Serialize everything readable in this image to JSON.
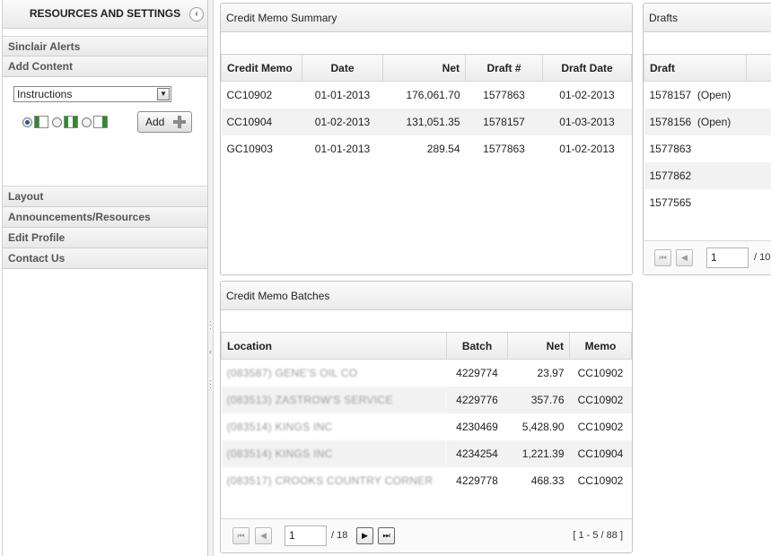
{
  "sidebar": {
    "title": "RESOURCES AND SETTINGS",
    "collapse_glyph": "‹",
    "sections": {
      "alerts": "Sinclair Alerts",
      "add_content": "Add Content",
      "layout": "Layout",
      "announcements": "Announcements/Resources",
      "edit_profile": "Edit Profile",
      "contact": "Contact Us"
    },
    "add_content": {
      "select_value": "Instructions",
      "add_label": "Add"
    }
  },
  "summary": {
    "title": "Credit Memo Summary",
    "columns": [
      "Credit Memo",
      "Date",
      "Net",
      "Draft #",
      "Draft Date"
    ],
    "rows": [
      [
        "CC10902",
        "01-01-2013",
        "176,061.70",
        "1577863",
        "01-02-2013"
      ],
      [
        "CC10904",
        "01-02-2013",
        "131,051.35",
        "1578157",
        "01-03-2013"
      ],
      [
        "GC10903",
        "01-01-2013",
        "289.54",
        "1577863",
        "01-02-2013"
      ]
    ]
  },
  "drafts": {
    "title": "Drafts",
    "columns": [
      "Draft"
    ],
    "rows": [
      "1578157  (Open)",
      "1578156  (Open)",
      "1577863",
      "1577862",
      "1577565"
    ],
    "pager": {
      "page": "1",
      "total": "/ 10"
    }
  },
  "batches": {
    "title": "Credit Memo Batches",
    "columns": [
      "Location",
      "Batch",
      "Net",
      "Memo"
    ],
    "rows": [
      [
        "(083587) GENE'S OIL CO",
        "4229774",
        "23.97",
        "CC10902"
      ],
      [
        "(083513) ZASTROW'S SERVICE",
        "4229776",
        "357.76",
        "CC10902"
      ],
      [
        "(083514) KINGS INC",
        "4230469",
        "5,428.90",
        "CC10902"
      ],
      [
        "(083514) KINGS INC",
        "4234254",
        "1,221.39",
        "CC10904"
      ],
      [
        "(083517) CROOKS COUNTRY CORNER",
        "4229778",
        "468.33",
        "CC10902"
      ]
    ],
    "pager": {
      "page": "1",
      "total": "/ 18",
      "range": "[ 1 - 5 / 88 ]"
    }
  },
  "icons": {
    "first": "⏮",
    "prev": "◀",
    "next": "▶",
    "last": "⏭",
    "dropdown": "▼"
  }
}
